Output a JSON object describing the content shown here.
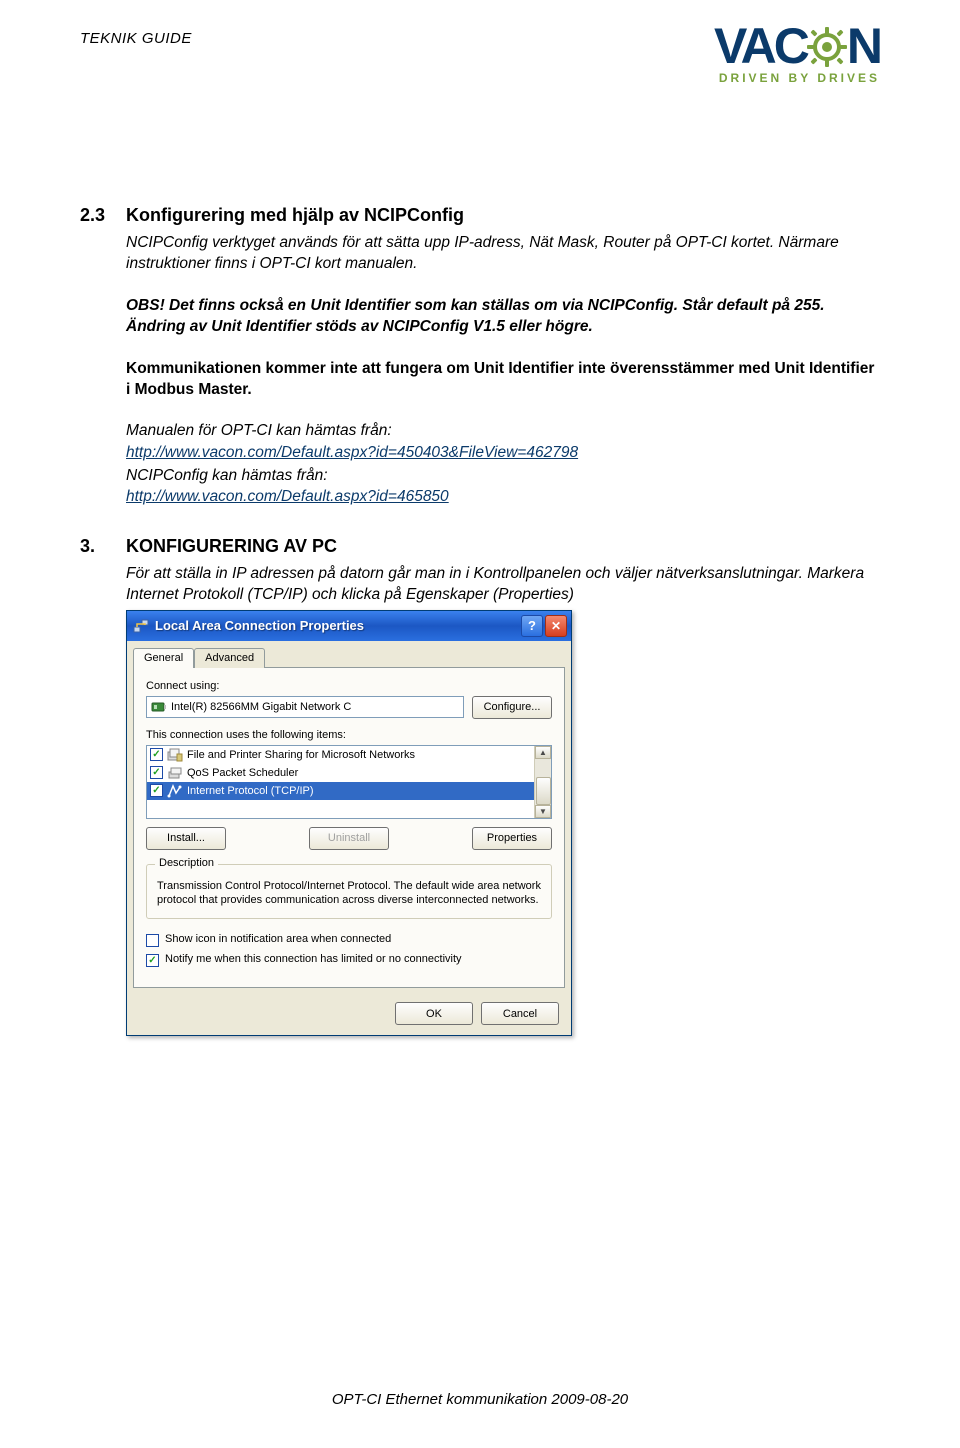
{
  "header": {
    "doc_title": "TEKNIK GUIDE",
    "brand_prefix": "VAC",
    "brand_suffix": "N",
    "brand_tag": "DRIVEN BY DRIVES"
  },
  "s23": {
    "num": "2.3",
    "title": "Konfigurering med hjälp av NCIPConfig",
    "p1": "NCIPConfig verktyget används för att sätta upp IP-adress, Nät Mask, Router på OPT-CI kortet. Närmare instruktioner finns i OPT-CI kort manualen.",
    "p2": "OBS! Det finns också en Unit Identifier som kan ställas om via NCIPConfig. Står default på 255. Ändring av Unit Identifier stöds av NCIPConfig V1.5 eller högre.",
    "p3": "Kommunikationen kommer inte att fungera om Unit Identifier inte överensstämmer med Unit Identifier i Modbus Master.",
    "p4a": "Manualen för OPT-CI kan hämtas från:",
    "link1": "http://www.vacon.com/Default.aspx?id=450403&FileView=462798",
    "p5a": "NCIPConfig kan hämtas från:",
    "link2": "http://www.vacon.com/Default.aspx?id=465850"
  },
  "s3": {
    "num": "3.",
    "title": "KONFIGURERING AV PC",
    "p1": "För att ställa in IP adressen på datorn går man in i Kontrollpanelen och väljer nätverksanslutningar. Markera Internet Protokoll (TCP/IP) och klicka på Egenskaper (Properties)"
  },
  "dialog": {
    "title": "Local Area Connection Properties",
    "tabs": {
      "general": "General",
      "advanced": "Advanced"
    },
    "connect_label": "Connect using:",
    "adapter": "Intel(R) 82566MM Gigabit Network C",
    "configure": "Configure...",
    "uses_label": "This connection uses the following items:",
    "items": [
      {
        "checked": true,
        "label": "File and Printer Sharing for Microsoft Networks",
        "selected": false,
        "icon": "service"
      },
      {
        "checked": true,
        "label": "QoS Packet Scheduler",
        "selected": false,
        "icon": "service"
      },
      {
        "checked": true,
        "label": "Internet Protocol (TCP/IP)",
        "selected": true,
        "icon": "protocol"
      }
    ],
    "install": "Install...",
    "uninstall": "Uninstall",
    "properties": "Properties",
    "desc_legend": "Description",
    "desc_text": "Transmission Control Protocol/Internet Protocol. The default wide area network protocol that provides communication across diverse interconnected networks.",
    "show_icon": "Show icon in notification area when connected",
    "notify": "Notify me when this connection has limited or no connectivity",
    "ok": "OK",
    "cancel": "Cancel"
  },
  "footer": "OPT-CI Ethernet kommunikation 2009-08-20"
}
